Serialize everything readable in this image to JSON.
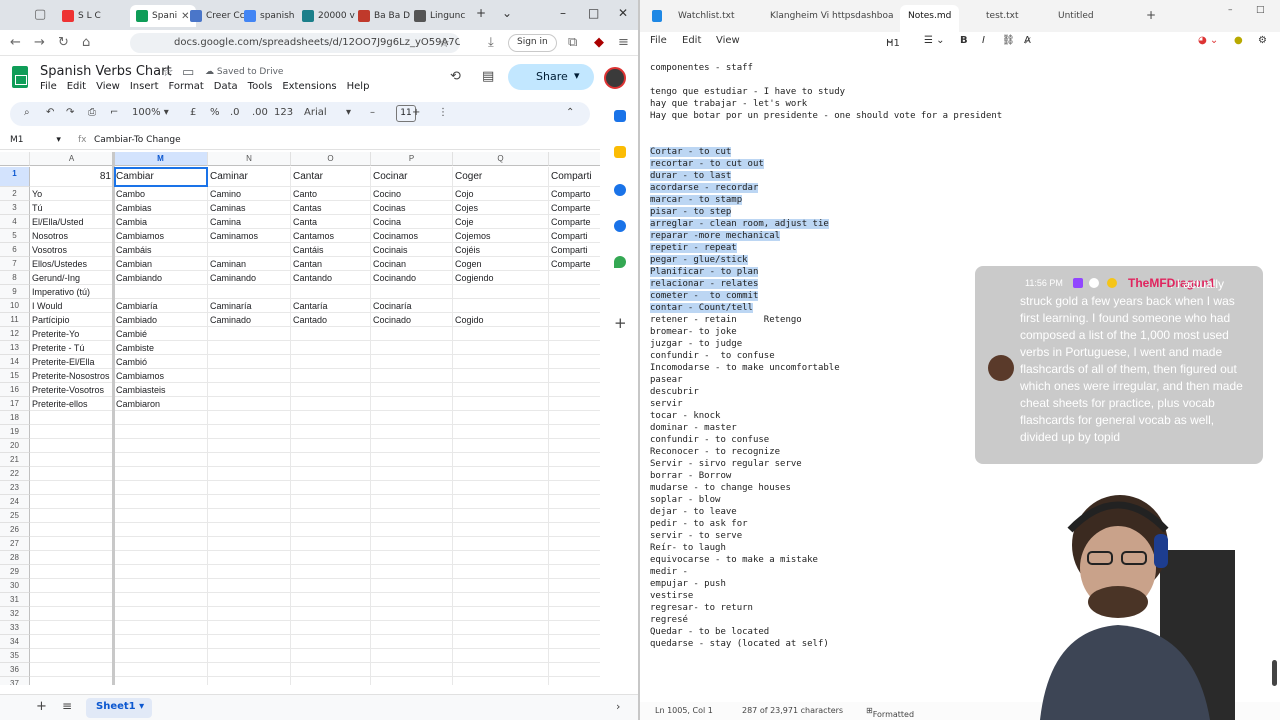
{
  "browser": {
    "tabs": [
      {
        "label": "S L C",
        "color": "#e33"
      },
      {
        "label": "Spani",
        "color": "#0f9d58",
        "active": true
      },
      {
        "label": "Creer Cc",
        "color": "#4a76c9"
      },
      {
        "label": "spanish",
        "color": "#4285f4"
      },
      {
        "label": "20000 v",
        "color": "#1b7f8a"
      },
      {
        "label": "Ba Ba D",
        "color": "#c0392b"
      },
      {
        "label": "Lingunc",
        "color": "#555"
      }
    ],
    "url": "docs.google.com/spreadsheets/d/12OO7J9g6Lz_yO59A7C6",
    "signin": "Sign in"
  },
  "sheets": {
    "title": "Spanish Verbs Chart",
    "saved_status": "Saved to Drive",
    "menu": [
      "File",
      "Edit",
      "View",
      "Insert",
      "Format",
      "Data",
      "Tools",
      "Extensions",
      "Help"
    ],
    "share_label": "Share",
    "toolbar": {
      "zoom": "100%",
      "currency": "£",
      "percent": "%",
      "dec_less": ".0",
      "dec_more": ".00",
      "format": "123",
      "font": "Arial",
      "font_size": "11"
    },
    "name_box": "M1",
    "formula": "Cambiar-To Change",
    "columns": [
      "A",
      "M",
      "N",
      "O",
      "P",
      "Q"
    ],
    "rows": [
      {
        "n": "1",
        "cells": [
          "81",
          "Cambiar",
          "Caminar",
          "Cantar",
          "Cocinar",
          "Coger",
          "Comparti"
        ]
      },
      {
        "n": "2",
        "cells": [
          "Yo",
          "Cambo",
          "Camino",
          "Canto",
          "Cocino",
          "Cojo",
          "Comparto"
        ]
      },
      {
        "n": "3",
        "cells": [
          "Tú",
          "Cambias",
          "Caminas",
          "Cantas",
          "Cocinas",
          "Cojes",
          "Comparte"
        ]
      },
      {
        "n": "4",
        "cells": [
          "El/Ella/Usted",
          "Cambia",
          "Camina",
          "Canta",
          "Cocina",
          "Coje",
          "Comparte"
        ]
      },
      {
        "n": "5",
        "cells": [
          "Nosotros",
          "Cambiamos",
          "Caminamos",
          "Cantamos",
          "Cocinamos",
          "Cojemos",
          "Comparti"
        ]
      },
      {
        "n": "6",
        "cells": [
          "Vosotros",
          "Cambáis",
          "",
          "Cantáis",
          "Cocinais",
          "Cojéis",
          "Comparti"
        ]
      },
      {
        "n": "7",
        "cells": [
          "Ellos/Ustedes",
          "Cambian",
          "Caminan",
          "Cantan",
          "Cocinan",
          "Cogen",
          "Comparte"
        ]
      },
      {
        "n": "8",
        "cells": [
          "Gerund/-Ing",
          "Cambiando",
          "Caminando",
          "Cantando",
          "Cocinando",
          "Cogiendo",
          ""
        ]
      },
      {
        "n": "9",
        "cells": [
          "Imperativo (tú)",
          "",
          "",
          "",
          "",
          "",
          ""
        ]
      },
      {
        "n": "10",
        "cells": [
          "I Would",
          "Cambiaría",
          "Caminaría",
          "Cantaría",
          "Cocinaría",
          "",
          ""
        ]
      },
      {
        "n": "11",
        "cells": [
          "Partícipio",
          "Cambiado",
          "Caminado",
          "Cantado",
          "Cocinado",
          "Cogido",
          ""
        ]
      },
      {
        "n": "12",
        "cells": [
          "Preterite-Yo",
          "Cambié",
          "",
          "",
          "",
          "",
          ""
        ]
      },
      {
        "n": "13",
        "cells": [
          "Preterite - Tú",
          "Cambiste",
          "",
          "",
          "",
          "",
          ""
        ]
      },
      {
        "n": "14",
        "cells": [
          "Preterite-El/Ella",
          "Cambió",
          "",
          "",
          "",
          "",
          ""
        ]
      },
      {
        "n": "15",
        "cells": [
          "Preterite-Nosostros",
          "Cambiamos",
          "",
          "",
          "",
          "",
          ""
        ]
      },
      {
        "n": "16",
        "cells": [
          "Preterite-Vosotros",
          "Cambiasteis",
          "",
          "",
          "",
          "",
          ""
        ]
      },
      {
        "n": "17",
        "cells": [
          "Preterite-ellos",
          "Cambiaron",
          "",
          "",
          "",
          "",
          ""
        ]
      }
    ],
    "empty_rows": [
      "18",
      "19",
      "20",
      "21",
      "22",
      "23",
      "24",
      "25",
      "26",
      "27",
      "28",
      "29",
      "30",
      "31",
      "32",
      "33",
      "34",
      "35",
      "36",
      "37"
    ],
    "sheet_tab": "Sheet1"
  },
  "notes": {
    "tabs": [
      "Watchlist.txt",
      "Klangheim Vi",
      "httpsdashboa",
      "Notes.md",
      "test.txt",
      "Untitled"
    ],
    "active_tab": "Notes.md",
    "menu": [
      "File",
      "Edit",
      "View"
    ],
    "heading_select": "H1",
    "lines": [
      {
        "t": "componentes - staff",
        "hl": false
      },
      {
        "t": "",
        "hl": false
      },
      {
        "t": "tengo que estudiar - I have to study",
        "hl": false
      },
      {
        "t": "hay que trabajar - let's work",
        "hl": false
      },
      {
        "t": "Hay que botar por un presidente - one should vote for a president",
        "hl": false
      },
      {
        "t": "",
        "hl": false
      },
      {
        "t": "",
        "hl": false
      },
      {
        "t": "Cortar - to cut",
        "hl": true
      },
      {
        "t": "recortar - to cut out",
        "hl": true
      },
      {
        "t": "durar - to last",
        "hl": true
      },
      {
        "t": "acordarse - recordar",
        "hl": true
      },
      {
        "t": "marcar - to stamp",
        "hl": true
      },
      {
        "t": "pisar - to step",
        "hl": true
      },
      {
        "t": "arreglar - clean room, adjust tie",
        "hl": true
      },
      {
        "t": "reparar -more mechanical",
        "hl": true
      },
      {
        "t": "repetir - repeat",
        "hl": true
      },
      {
        "t": "pegar - glue/stick",
        "hl": true
      },
      {
        "t": "Planificar - to plan",
        "hl": true
      },
      {
        "t": "relacionar - relates",
        "hl": true
      },
      {
        "t": "cometer -  to commit",
        "hl": true
      },
      {
        "t": "contar - Count/tell",
        "hl": true
      },
      {
        "t": "retener - retain     Retengo",
        "hl": false
      },
      {
        "t": "bromear- to joke",
        "hl": false
      },
      {
        "t": "juzgar - to judge",
        "hl": false
      },
      {
        "t": "confundir -  to confuse",
        "hl": false
      },
      {
        "t": "Incomodarse - to make uncomfortable",
        "hl": false
      },
      {
        "t": "pasear",
        "hl": false
      },
      {
        "t": "descubrir",
        "hl": false
      },
      {
        "t": "servir",
        "hl": false
      },
      {
        "t": "tocar - knock",
        "hl": false
      },
      {
        "t": "dominar - master",
        "hl": false
      },
      {
        "t": "confundir - to confuse",
        "hl": false
      },
      {
        "t": "Reconocer - to recognize",
        "hl": false
      },
      {
        "t": "Servir - sirvo regular serve",
        "hl": false
      },
      {
        "t": "borrar - Borrow",
        "hl": false
      },
      {
        "t": "mudarse - to change houses",
        "hl": false
      },
      {
        "t": "soplar - blow",
        "hl": false
      },
      {
        "t": "dejar - to leave",
        "hl": false
      },
      {
        "t": "pedir - to ask for",
        "hl": false
      },
      {
        "t": "servir - to serve",
        "hl": false
      },
      {
        "t": "Reír- to laugh",
        "hl": false
      },
      {
        "t": "equivocarse - to make a mistake",
        "hl": false
      },
      {
        "t": "medir -",
        "hl": false
      },
      {
        "t": "empujar - push",
        "hl": false
      },
      {
        "t": "vestirse",
        "hl": false
      },
      {
        "t": "regresar- to return",
        "hl": false
      },
      {
        "t": "regresé",
        "hl": false
      },
      {
        "t": "Quedar - to be located",
        "hl": false
      },
      {
        "t": "quedarse - stay (located at self)",
        "hl": false
      }
    ],
    "status": {
      "position": "Ln 1005, Col 1",
      "chars": "287 of 23,971 characters",
      "mode": "Formatted"
    }
  },
  "chat": {
    "time": "11:56 PM",
    "user": "TheMFDragon1",
    "message": ": I actually struck gold a few years back when I was first learning. I found someone who had composed a list of the 1,000 most used verbs in Portuguese, I went and made flashcards of all of them, then figured out which ones were irregular, and then made cheat sheets for practice, plus vocab flashcards for general vocab as well, divided up by topid"
  }
}
